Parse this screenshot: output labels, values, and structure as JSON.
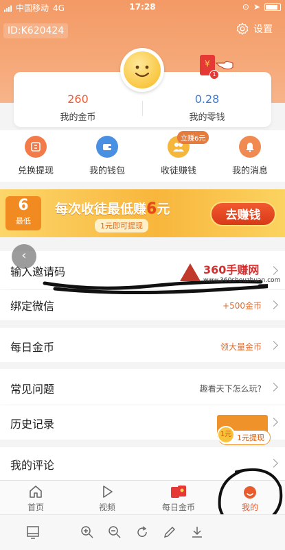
{
  "status_bar": {
    "carrier": "中国移动",
    "network": "4G",
    "time": "17:28"
  },
  "header": {
    "user_id": "ID:K620424",
    "settings_label": "设置"
  },
  "stats": {
    "coins": {
      "value": "260",
      "label": "我的金币"
    },
    "change": {
      "value": "0.28",
      "label": "我的零钱"
    },
    "notification_count": "1",
    "redpacket_symbol": "¥"
  },
  "quick_menu": [
    {
      "label": "兑换提现",
      "icon": "exchange-icon",
      "color": "#f37b4a"
    },
    {
      "label": "我的钱包",
      "icon": "wallet-icon",
      "color": "#4a90e2"
    },
    {
      "label": "收徒赚钱",
      "icon": "people-icon",
      "color": "#f5b73b"
    },
    {
      "label": "我的消息",
      "icon": "bell-icon",
      "color": "#f08a50"
    }
  ],
  "quick_menu_tag": "立赚6元",
  "banner": {
    "badge_number": "6",
    "badge_text": "最低",
    "title_prefix": "每次收徒最低赚",
    "title_amount": "6",
    "title_suffix": "元",
    "subtitle": "1元即可提现",
    "button_label": "去赚钱"
  },
  "rows": [
    {
      "title": "输入邀请码",
      "extra": ""
    },
    {
      "title": "绑定微信",
      "extra": "+500金币"
    },
    {
      "title": "每日金币",
      "extra": "领大量金币"
    },
    {
      "title": "常见问题",
      "extra": "趣看天下怎么玩?"
    },
    {
      "title": "历史记录",
      "extra": ""
    },
    {
      "title": "我的评论",
      "extra": ""
    }
  ],
  "watermark": {
    "name": "360手赚网",
    "url": "www.360shouzhuan.com"
  },
  "float_badge": {
    "coin_text": "1元",
    "label": "1元提现"
  },
  "tabs": [
    {
      "label": "首页",
      "icon": "home-icon"
    },
    {
      "label": "视频",
      "icon": "play-icon"
    },
    {
      "label": "每日金币",
      "icon": "redpacket-icon"
    },
    {
      "label": "我的",
      "icon": "profile-icon"
    }
  ],
  "colors": {
    "accent": "#e95a2c",
    "header": "#f39a66",
    "extra_text": "#e26a2c"
  }
}
